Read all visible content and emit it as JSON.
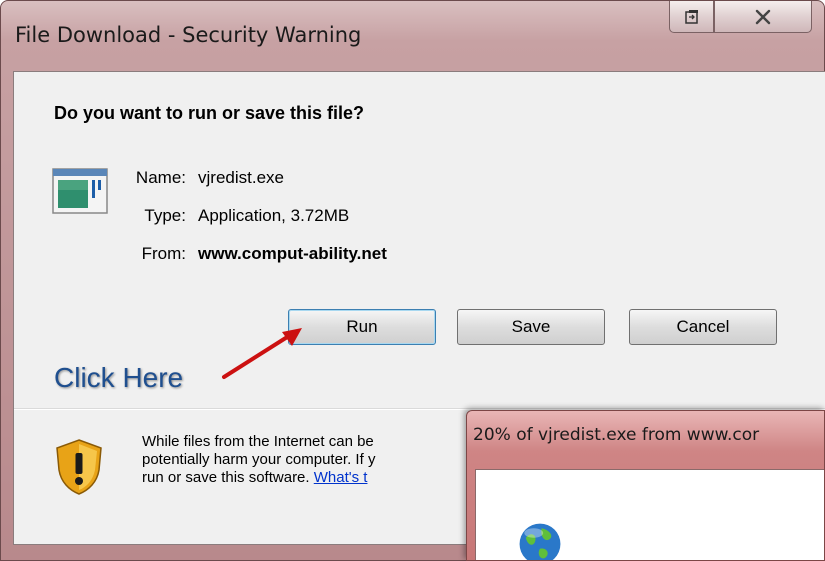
{
  "window": {
    "title": "File Download - Security Warning"
  },
  "dialog": {
    "question": "Do you want to run or save this file?",
    "name_label": "Name:",
    "name_value": "vjredist.exe",
    "type_label": "Type:",
    "type_value": "Application, 3.72MB",
    "from_label": "From:",
    "from_value": "www.comput-ability.net",
    "buttons": {
      "run": "Run",
      "save": "Save",
      "cancel": "Cancel"
    },
    "annotation": "Click Here",
    "warning_line1": "While files from the Internet can be",
    "warning_line2": "potentially harm your computer. If y",
    "warning_line3": "run or save this software. ",
    "warning_link": "What's t"
  },
  "progress_window": {
    "title": "20% of vjredist.exe from www.cor",
    "percent": 20
  },
  "colors": {
    "title_bar": "#c7a1a3",
    "annotation": "#1f4f8f",
    "arrow": "#cc1111",
    "link": "#0033cc",
    "progress_title_bar": "#cf8585"
  },
  "icons": [
    "restore-icon",
    "close-icon",
    "application-file-icon",
    "security-shield-icon",
    "globe-icon"
  ]
}
